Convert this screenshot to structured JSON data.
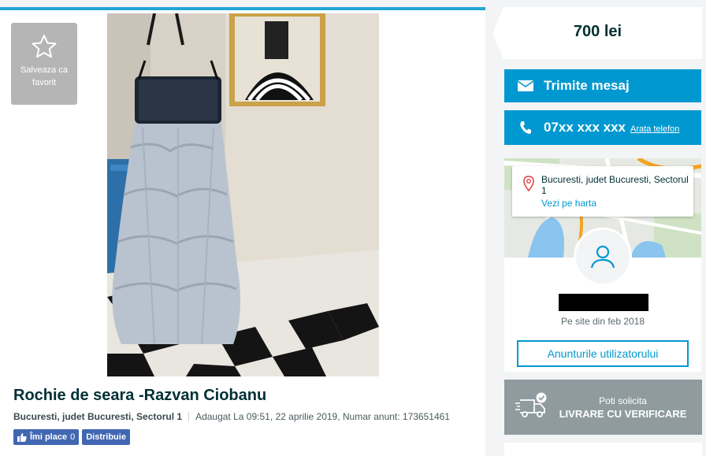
{
  "listing": {
    "favorite_label": "Salveaza ca favorit",
    "title": "Rochie de seara -Razvan Ciobanu",
    "location": "Bucuresti, judet Bucuresti, Sectorul 1",
    "added": "Adaugat La 09:51, 22 aprilie 2019, Numar anunt: 173651461",
    "like_label": "Îmi place",
    "like_count": "0",
    "share_label": "Distribuie"
  },
  "sidebar": {
    "price": "700 lei",
    "message_button": "Trimite mesaj",
    "phone_number": "07xx xxx xxx",
    "show_phone": "Arata telefon",
    "map_address": "Bucuresti, judet Bucuresti, Sectorul 1",
    "map_link": "Vezi pe harta",
    "member_since": "Pe site din feb 2018",
    "user_ads_button": "Anunturile utilizatorului",
    "delivery_line1": "Poti solicita",
    "delivery_line2": "LIVRARE CU VERIFICARE"
  },
  "icons": {
    "favorite": "star-outline-icon",
    "message": "envelope-icon",
    "phone": "phone-icon",
    "location": "map-pin-icon",
    "user": "user-avatar-icon",
    "delivery": "delivery-truck-icon",
    "like": "thumbs-up-icon"
  },
  "colors": {
    "accent": "#0098d0",
    "accent_top_bar": "#23a6d5",
    "facebook": "#4267b2",
    "delivery_bg": "#8f9b9e",
    "text": "#002f34"
  }
}
